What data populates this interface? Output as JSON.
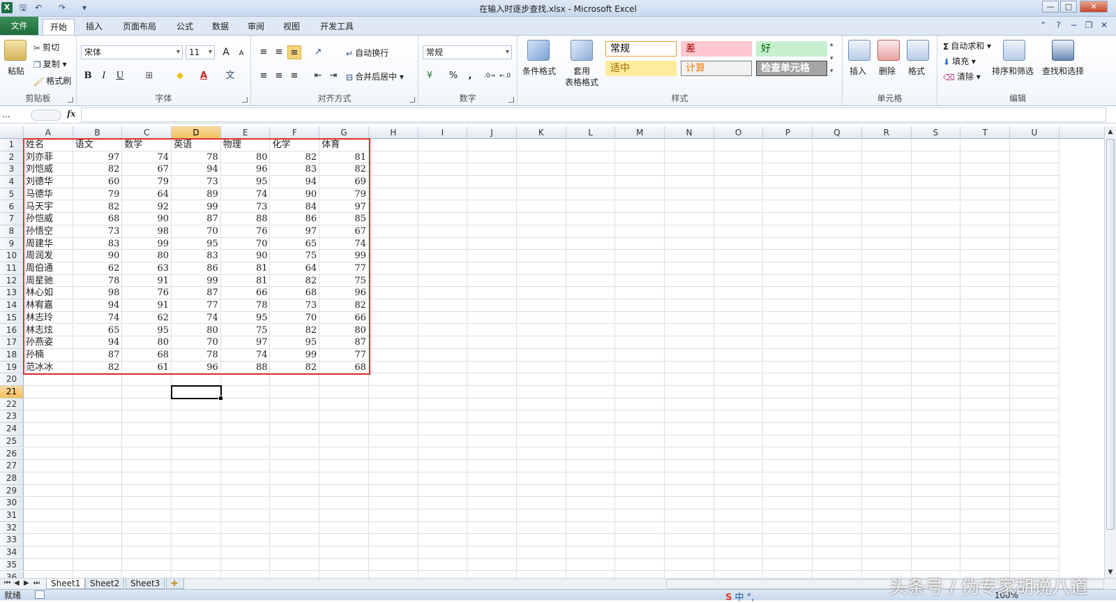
{
  "window": {
    "title": "在输入时逐步查找.xlsx - Microsoft Excel",
    "logo": "X",
    "controls": [
      "—",
      "□",
      "✕"
    ]
  },
  "ribbon_tabs": [
    "文件",
    "开始",
    "插入",
    "页面布局",
    "公式",
    "数据",
    "审阅",
    "视图",
    "开发工具"
  ],
  "clipboard": {
    "label": "剪贴板",
    "paste": "粘贴",
    "cut": "剪切",
    "copy": "复制",
    "format_painter": "格式刷"
  },
  "font": {
    "label": "字体",
    "name": "宋体",
    "size": "11",
    "grow": "A",
    "shrink": "A",
    "bold": "B",
    "italic": "I",
    "underline": "U"
  },
  "alignment": {
    "label": "对齐方式",
    "wrap": "自动换行",
    "merge": "合并后居中"
  },
  "number": {
    "label": "数字",
    "format": "常规",
    "percent": "%",
    "comma": ","
  },
  "styles": {
    "label": "样式",
    "conditional": "条件格式",
    "table1": "套用",
    "table2": "表格格式",
    "cells": [
      {
        "name": "常规",
        "bg": "#ffffff",
        "color": "#000000",
        "border": "#f0a030"
      },
      {
        "name": "差",
        "bg": "#ffc7ce",
        "color": "#9c0006",
        "border": "#ffc7ce"
      },
      {
        "name": "好",
        "bg": "#c6efce",
        "color": "#006100",
        "border": "#c6efce"
      },
      {
        "name": "适中",
        "bg": "#ffeb9c",
        "color": "#9c6500",
        "border": "#ffeb9c"
      },
      {
        "name": "计算",
        "bg": "#f2f2f2",
        "color": "#fa7d00",
        "border": "#7f7f7f"
      },
      {
        "name": "检查单元格",
        "bg": "#a5a5a5",
        "color": "#ffffff",
        "border": "#3f3f3f"
      }
    ]
  },
  "cells_group": {
    "label": "单元格",
    "insert": "插入",
    "delete": "删除",
    "format": "格式"
  },
  "editing": {
    "label": "编辑",
    "autosum": "自动求和",
    "fill": "填充",
    "clear": "清除",
    "sort": "排序和筛选",
    "find": "查找和选择"
  },
  "formula_bar": {
    "name_box": "...",
    "fx": "fx",
    "content": ""
  },
  "columns": [
    "A",
    "B",
    "C",
    "D",
    "E",
    "F",
    "G",
    "H",
    "I",
    "J",
    "K",
    "L",
    "M",
    "N",
    "O",
    "P",
    "Q",
    "R",
    "S",
    "T",
    "U"
  ],
  "selected_column": "D",
  "selected_row": 21,
  "headers": [
    "姓名",
    "语文",
    "数学",
    "英语",
    "物理",
    "化学",
    "体育"
  ],
  "rows": [
    [
      "刘亦菲",
      97,
      74,
      78,
      80,
      82,
      81
    ],
    [
      "刘恺威",
      82,
      67,
      94,
      96,
      83,
      82
    ],
    [
      "刘德华",
      60,
      79,
      73,
      95,
      94,
      69
    ],
    [
      "马德华",
      79,
      64,
      89,
      74,
      90,
      79
    ],
    [
      "马天宇",
      82,
      92,
      99,
      73,
      84,
      97
    ],
    [
      "孙恺威",
      68,
      90,
      87,
      88,
      86,
      85
    ],
    [
      "孙悟空",
      73,
      98,
      70,
      76,
      97,
      67
    ],
    [
      "周建华",
      83,
      99,
      95,
      70,
      65,
      74
    ],
    [
      "周润发",
      90,
      80,
      83,
      90,
      75,
      99
    ],
    [
      "周伯通",
      62,
      63,
      86,
      81,
      64,
      77
    ],
    [
      "周星驰",
      78,
      91,
      99,
      81,
      82,
      75
    ],
    [
      "林心如",
      98,
      76,
      87,
      66,
      68,
      96
    ],
    [
      "林宥嘉",
      94,
      91,
      77,
      78,
      73,
      82
    ],
    [
      "林志玲",
      74,
      62,
      74,
      95,
      70,
      66
    ],
    [
      "林志炫",
      65,
      95,
      80,
      75,
      82,
      80
    ],
    [
      "孙燕姿",
      94,
      80,
      70,
      97,
      95,
      87
    ],
    [
      "孙楠",
      87,
      68,
      78,
      74,
      99,
      77
    ],
    [
      "范冰冰",
      82,
      61,
      96,
      88,
      82,
      68
    ]
  ],
  "sheets": [
    "Sheet1",
    "Sheet2",
    "Sheet3"
  ],
  "active_sheet": "Sheet1",
  "status": {
    "ready": "就绪",
    "zoom": "100%",
    "ime": "中 °,"
  },
  "watermark": "头条号 / 伪专家胡说八道",
  "highlight_color": "#e0302f"
}
